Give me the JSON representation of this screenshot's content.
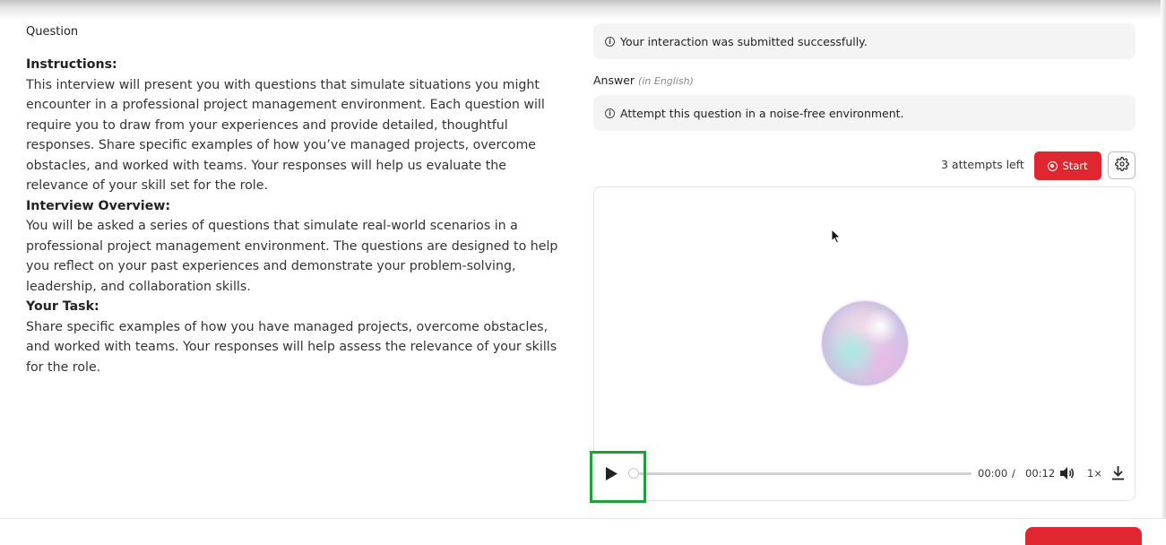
{
  "question": {
    "label": "Question",
    "instructions_heading": "Instructions:",
    "instructions_text": "This interview will present you with questions that simulate situations you might encounter in a professional project management environment. Each question will require you to draw from your experiences and provide detailed, thoughtful responses. Share specific examples of how you’ve managed projects, overcome obstacles, and worked with teams. Your responses will help us evaluate the relevance of your skill set for the role.",
    "overview_heading": "Interview Overview:",
    "overview_text": "You will be asked a series of questions that simulate real-world scenarios in a professional project management environment. The questions are designed to help you reflect on your past experiences and demonstrate your problem-solving, leadership, and collaboration skills.",
    "task_heading": "Your Task:",
    "task_text": "Share specific examples of how you have managed projects, overcome obstacles, and worked with teams. Your responses will help assess the relevance of your skills for the role."
  },
  "notices": {
    "submitted": "Your interaction was submitted successfully.",
    "environment": "Attempt this question in a noise-free environment."
  },
  "answer": {
    "label": "Answer",
    "language": "(in English)"
  },
  "recorder": {
    "attempts_left": "3 attempts left",
    "start_label": "Start"
  },
  "player": {
    "current_time": "00:00",
    "separator": "/",
    "total_time": "00:12",
    "speed": "1×",
    "progress": 0
  },
  "colors": {
    "accent_red": "#e0262e",
    "highlight_green": "#1f9e3a"
  },
  "icons": [
    "info-icon",
    "record-icon",
    "gear-icon",
    "play-icon",
    "volume-icon",
    "download-icon",
    "cursor-icon"
  ]
}
